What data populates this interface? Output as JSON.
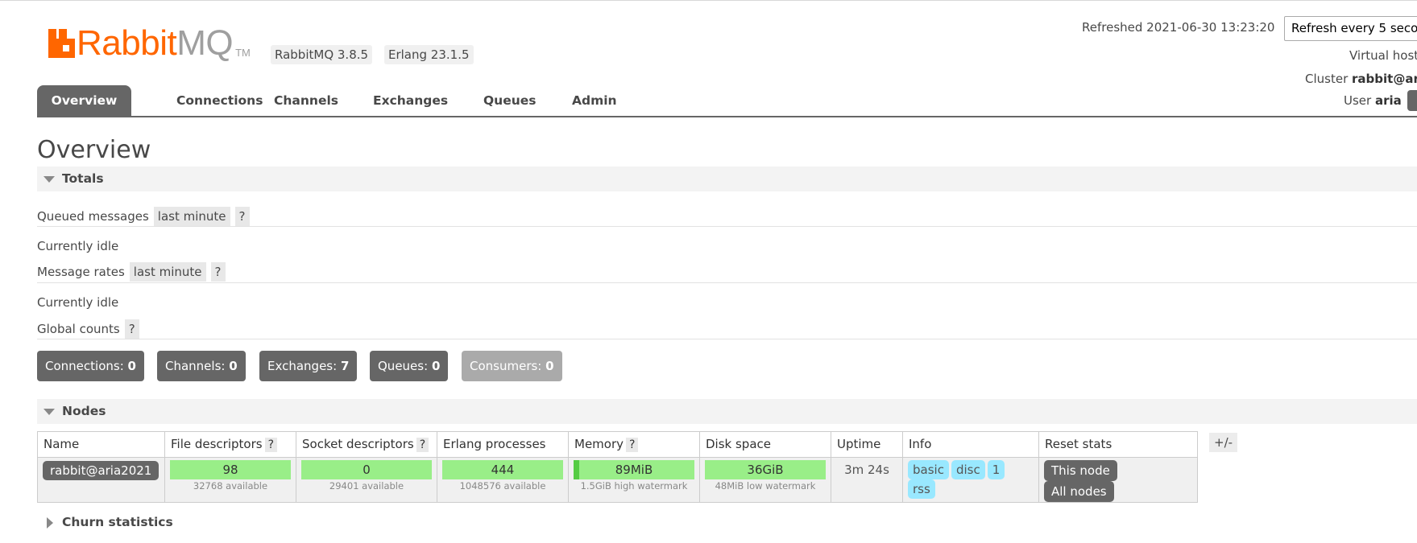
{
  "header": {
    "logo_text_primary": "Rabbit",
    "logo_text_secondary": "MQ",
    "logo_tm": "TM",
    "rabbitmq_version": "RabbitMQ 3.8.5",
    "erlang_version": "Erlang 23.1.5",
    "refreshed": "Refreshed 2021-06-30 13:23:20",
    "refresh_select": "Refresh every 5 seco",
    "virtual_host_label": "Virtual host",
    "cluster_label": "Cluster",
    "cluster_value": "rabbit@ar",
    "user_label": "User",
    "user_value": "aria"
  },
  "tabs": [
    {
      "label": "Overview",
      "active": true
    },
    {
      "label": "Connections"
    },
    {
      "label": "Channels"
    },
    {
      "label": "Exchanges"
    },
    {
      "label": "Queues"
    },
    {
      "label": "Admin"
    }
  ],
  "main": {
    "title": "Overview",
    "totals_heading": "Totals",
    "queued_messages_label": "Queued messages",
    "queued_range": "last minute",
    "help": "?",
    "currently_idle_1": "Currently idle",
    "message_rates_label": "Message rates",
    "rates_range": "last minute",
    "currently_idle_2": "Currently idle",
    "global_counts_label": "Global counts",
    "counts": {
      "connections_label": "Connections:",
      "connections_value": "0",
      "channels_label": "Channels:",
      "channels_value": "0",
      "exchanges_label": "Exchanges:",
      "exchanges_value": "7",
      "queues_label": "Queues:",
      "queues_value": "0",
      "consumers_label": "Consumers:",
      "consumers_value": "0"
    },
    "nodes_heading": "Nodes",
    "churn_heading": "Churn statistics"
  },
  "nodes_table": {
    "columns": {
      "name": "Name",
      "file_descriptors": "File descriptors",
      "socket_descriptors": "Socket descriptors",
      "erlang_processes": "Erlang processes",
      "memory": "Memory",
      "disk_space": "Disk space",
      "uptime": "Uptime",
      "info": "Info",
      "reset_stats": "Reset stats"
    },
    "toggle_columns": "+/-",
    "row": {
      "name": "rabbit@aria2021",
      "file_descriptors": "98",
      "file_descriptors_sub": "32768 available",
      "socket_descriptors": "0",
      "socket_descriptors_sub": "29401 available",
      "erlang_processes": "444",
      "erlang_processes_sub": "1048576 available",
      "memory": "89MiB",
      "memory_sub": "1.5GiB high watermark",
      "disk_space": "36GiB",
      "disk_space_sub": "48MiB low watermark",
      "uptime": "3m 24s",
      "info_badges": [
        "basic",
        "disc",
        "1",
        "rss"
      ],
      "reset_this_node": "This node",
      "reset_all_nodes": "All nodes"
    }
  },
  "colors": {
    "brand_orange": "#ff6600",
    "tab_active": "#666666",
    "bar_green": "#99ee88",
    "info_badge": "#99e8ff"
  }
}
